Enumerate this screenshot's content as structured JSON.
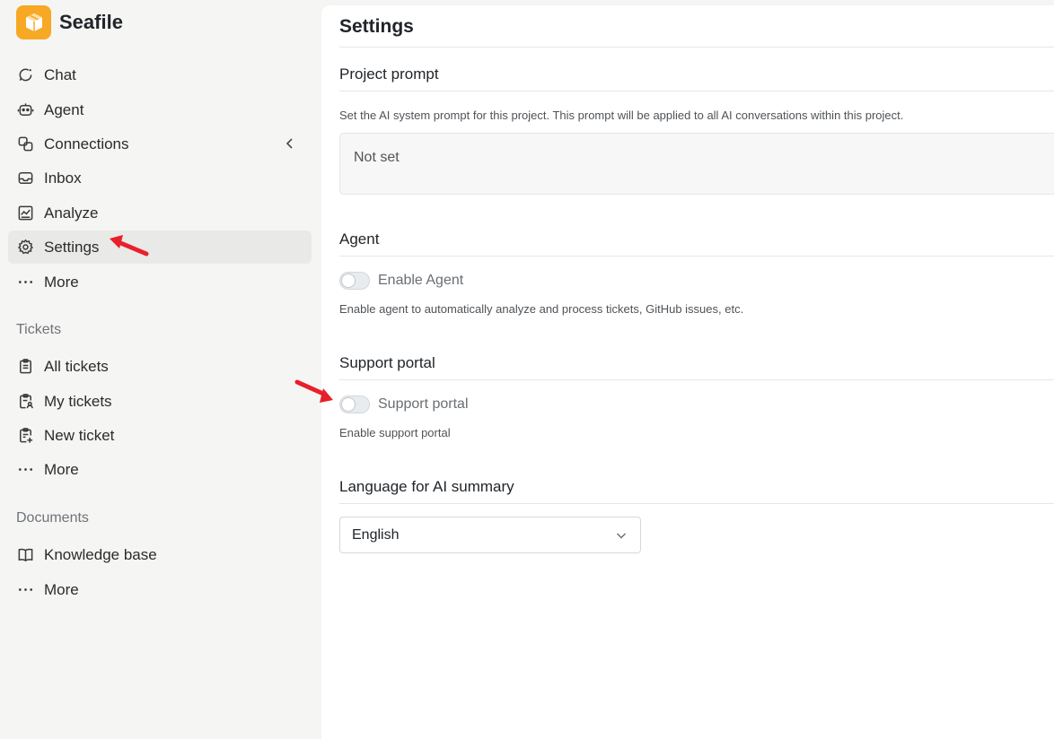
{
  "app": {
    "name": "Seafile",
    "accent_color": "#f7a825"
  },
  "sidebar": {
    "nav": [
      {
        "label": "Chat",
        "icon": "chat-icon"
      },
      {
        "label": "Agent",
        "icon": "robot-icon"
      },
      {
        "label": "Connections",
        "icon": "link-icon"
      },
      {
        "label": "Inbox",
        "icon": "inbox-icon"
      },
      {
        "label": "Analyze",
        "icon": "chart-icon"
      },
      {
        "label": "Settings",
        "icon": "gear-icon",
        "active": true
      },
      {
        "label": "More",
        "icon": "more-icon"
      }
    ],
    "tickets": {
      "title": "Tickets",
      "items": [
        {
          "label": "All tickets",
          "icon": "clipboard-icon"
        },
        {
          "label": "My tickets",
          "icon": "user-clipboard-icon"
        },
        {
          "label": "New ticket",
          "icon": "new-ticket-icon"
        },
        {
          "label": "More",
          "icon": "more-icon"
        }
      ]
    },
    "documents": {
      "title": "Documents",
      "items": [
        {
          "label": "Knowledge base",
          "icon": "book-icon"
        },
        {
          "label": "More",
          "icon": "more-icon"
        }
      ]
    }
  },
  "main": {
    "title": "Settings",
    "project_prompt": {
      "heading": "Project prompt",
      "description": "Set the AI system prompt for this project. This prompt will be applied to all AI conversations within this project.",
      "value": "Not set"
    },
    "agent": {
      "heading": "Agent",
      "toggle_label": "Enable Agent",
      "enabled": false,
      "description": "Enable agent to automatically analyze and process tickets, GitHub issues, etc."
    },
    "support_portal": {
      "heading": "Support portal",
      "toggle_label": "Support portal",
      "enabled": false,
      "description": "Enable support portal"
    },
    "language": {
      "heading": "Language for AI summary",
      "selected": "English"
    }
  },
  "annotation_color": "#e8202a"
}
